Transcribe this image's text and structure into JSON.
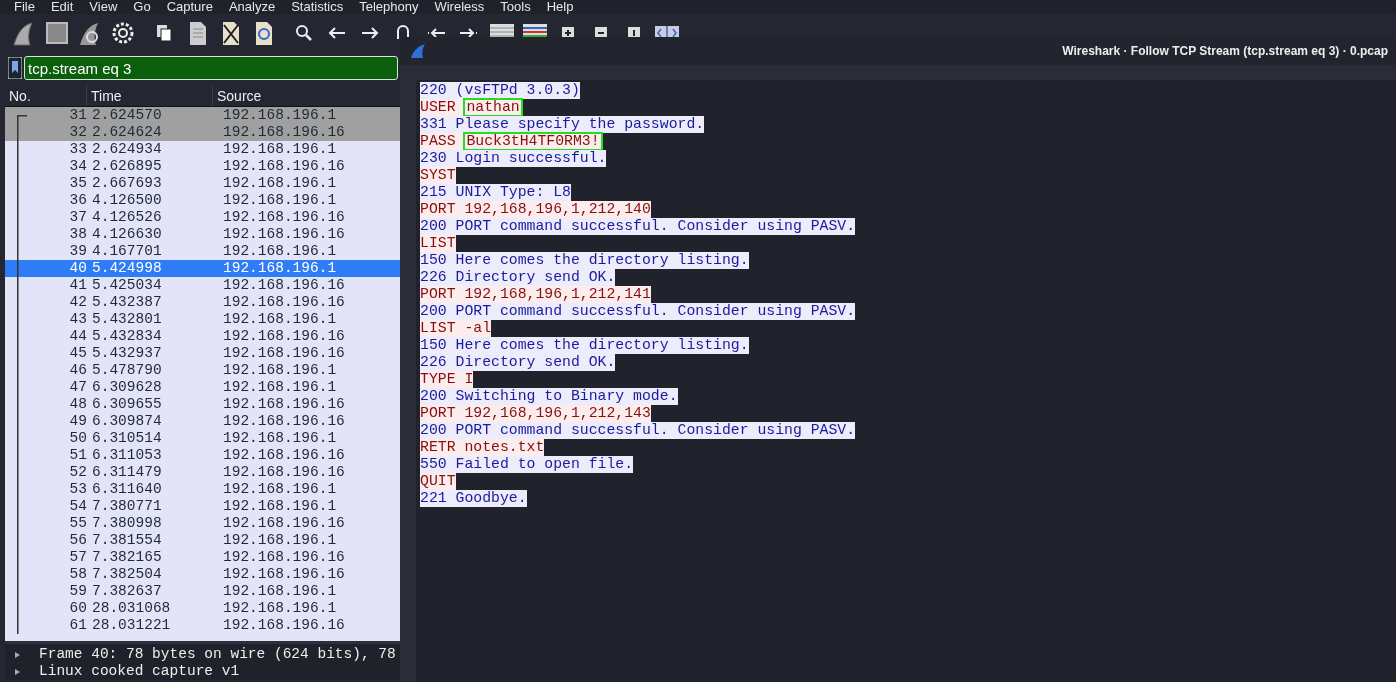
{
  "menu": [
    "File",
    "Edit",
    "View",
    "Go",
    "Capture",
    "Analyze",
    "Statistics",
    "Telephony",
    "Wireless",
    "Tools",
    "Help"
  ],
  "filter": {
    "value": "tcp.stream eq 3"
  },
  "packet_list": {
    "columns": [
      "No.",
      "Time",
      "Source"
    ],
    "rows": [
      {
        "no": "31",
        "time": "2.624570",
        "source": "192.168.196.1",
        "color": "#a0a0a0",
        "selected": false
      },
      {
        "no": "32",
        "time": "2.624624",
        "source": "192.168.196.16",
        "color": "#a0a0a0",
        "selected": false
      },
      {
        "no": "33",
        "time": "2.624934",
        "source": "192.168.196.1",
        "color": "#e4e4f8",
        "selected": false
      },
      {
        "no": "34",
        "time": "2.626895",
        "source": "192.168.196.16",
        "color": "#e4e4f8",
        "selected": false
      },
      {
        "no": "35",
        "time": "2.667693",
        "source": "192.168.196.1",
        "color": "#e4e4f8",
        "selected": false
      },
      {
        "no": "36",
        "time": "4.126500",
        "source": "192.168.196.1",
        "color": "#e4e4f8",
        "selected": false
      },
      {
        "no": "37",
        "time": "4.126526",
        "source": "192.168.196.16",
        "color": "#e4e4f8",
        "selected": false
      },
      {
        "no": "38",
        "time": "4.126630",
        "source": "192.168.196.16",
        "color": "#e4e4f8",
        "selected": false
      },
      {
        "no": "39",
        "time": "4.167701",
        "source": "192.168.196.1",
        "color": "#e4e4f8",
        "selected": false
      },
      {
        "no": "40",
        "time": "5.424998",
        "source": "192.168.196.1",
        "color": "#2f7df6",
        "selected": true
      },
      {
        "no": "41",
        "time": "5.425034",
        "source": "192.168.196.16",
        "color": "#e4e4f8",
        "selected": false
      },
      {
        "no": "42",
        "time": "5.432387",
        "source": "192.168.196.16",
        "color": "#e4e4f8",
        "selected": false
      },
      {
        "no": "43",
        "time": "5.432801",
        "source": "192.168.196.1",
        "color": "#e4e4f8",
        "selected": false
      },
      {
        "no": "44",
        "time": "5.432834",
        "source": "192.168.196.16",
        "color": "#e4e4f8",
        "selected": false
      },
      {
        "no": "45",
        "time": "5.432937",
        "source": "192.168.196.16",
        "color": "#e4e4f8",
        "selected": false
      },
      {
        "no": "46",
        "time": "5.478790",
        "source": "192.168.196.1",
        "color": "#e4e4f8",
        "selected": false
      },
      {
        "no": "47",
        "time": "6.309628",
        "source": "192.168.196.1",
        "color": "#e4e4f8",
        "selected": false
      },
      {
        "no": "48",
        "time": "6.309655",
        "source": "192.168.196.16",
        "color": "#e4e4f8",
        "selected": false
      },
      {
        "no": "49",
        "time": "6.309874",
        "source": "192.168.196.16",
        "color": "#e4e4f8",
        "selected": false
      },
      {
        "no": "50",
        "time": "6.310514",
        "source": "192.168.196.1",
        "color": "#e4e4f8",
        "selected": false
      },
      {
        "no": "51",
        "time": "6.311053",
        "source": "192.168.196.16",
        "color": "#e4e4f8",
        "selected": false
      },
      {
        "no": "52",
        "time": "6.311479",
        "source": "192.168.196.16",
        "color": "#e4e4f8",
        "selected": false
      },
      {
        "no": "53",
        "time": "6.311640",
        "source": "192.168.196.1",
        "color": "#e4e4f8",
        "selected": false
      },
      {
        "no": "54",
        "time": "7.380771",
        "source": "192.168.196.1",
        "color": "#e4e4f8",
        "selected": false
      },
      {
        "no": "55",
        "time": "7.380998",
        "source": "192.168.196.16",
        "color": "#e4e4f8",
        "selected": false
      },
      {
        "no": "56",
        "time": "7.381554",
        "source": "192.168.196.1",
        "color": "#e4e4f8",
        "selected": false
      },
      {
        "no": "57",
        "time": "7.382165",
        "source": "192.168.196.16",
        "color": "#e4e4f8",
        "selected": false
      },
      {
        "no": "58",
        "time": "7.382504",
        "source": "192.168.196.16",
        "color": "#e4e4f8",
        "selected": false
      },
      {
        "no": "59",
        "time": "7.382637",
        "source": "192.168.196.1",
        "color": "#e4e4f8",
        "selected": false
      },
      {
        "no": "60",
        "time": "28.031068",
        "source": "192.168.196.1",
        "color": "#e4e4f8",
        "selected": false
      },
      {
        "no": "61",
        "time": "28.031221",
        "source": "192.168.196.16",
        "color": "#e4e4f8",
        "selected": false
      }
    ]
  },
  "details": [
    {
      "text": "Frame 40: 78 bytes on wire (624 bits), 78",
      "expanded": false
    },
    {
      "text": "Linux cooked capture v1",
      "expanded": false
    }
  ],
  "stream_window": {
    "title": "Wireshark · Follow TCP Stream (tcp.stream eq 3) · 0.pcap",
    "lines": [
      {
        "kind": "server",
        "text": "220 (vsFTPd 3.0.3)"
      },
      {
        "kind": "client",
        "text": "USER ",
        "boxed": "nathan"
      },
      {
        "kind": "server",
        "text": "331 Please specify the password."
      },
      {
        "kind": "client",
        "text": "PASS ",
        "boxed": "Buck3tH4TF0RM3!"
      },
      {
        "kind": "server",
        "text": "230 Login successful."
      },
      {
        "kind": "client",
        "text": "SYST"
      },
      {
        "kind": "server",
        "text": "215 UNIX Type: L8"
      },
      {
        "kind": "client",
        "text": "PORT 192,168,196,1,212,140"
      },
      {
        "kind": "server",
        "text": "200 PORT command successful. Consider using PASV."
      },
      {
        "kind": "client",
        "text": "LIST"
      },
      {
        "kind": "server",
        "text": "150 Here comes the directory listing."
      },
      {
        "kind": "server",
        "text": "226 Directory send OK."
      },
      {
        "kind": "client",
        "text": "PORT 192,168,196,1,212,141"
      },
      {
        "kind": "server",
        "text": "200 PORT command successful. Consider using PASV."
      },
      {
        "kind": "client",
        "text": "LIST -al"
      },
      {
        "kind": "server",
        "text": "150 Here comes the directory listing."
      },
      {
        "kind": "server",
        "text": "226 Directory send OK."
      },
      {
        "kind": "client",
        "text": "TYPE I"
      },
      {
        "kind": "server",
        "text": "200 Switching to Binary mode."
      },
      {
        "kind": "client",
        "text": "PORT 192,168,196,1,212,143"
      },
      {
        "kind": "server",
        "text": "200 PORT command successful. Consider using PASV."
      },
      {
        "kind": "client",
        "text": "RETR notes.txt"
      },
      {
        "kind": "server",
        "text": "550 Failed to open file."
      },
      {
        "kind": "client",
        "text": "QUIT"
      },
      {
        "kind": "server",
        "text": "221 Goodbye."
      }
    ]
  }
}
